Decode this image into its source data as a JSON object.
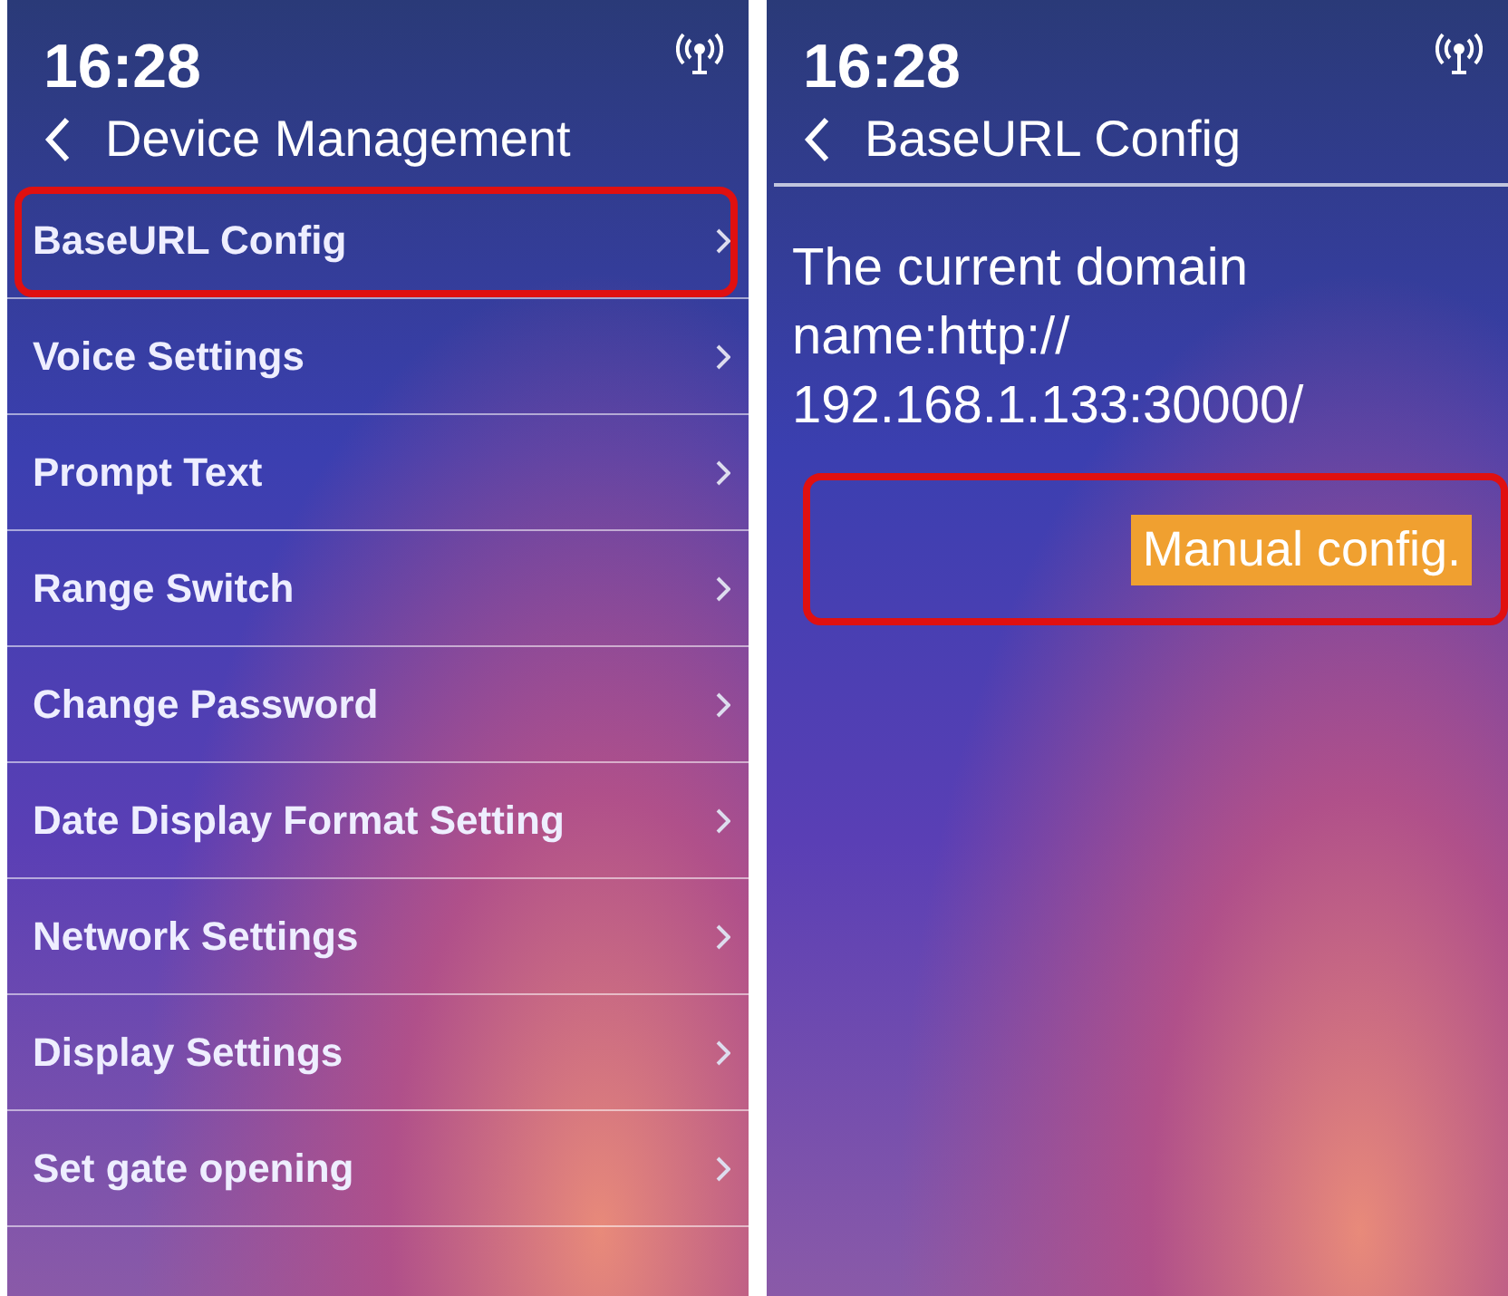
{
  "screens": [
    {
      "time": "16:28",
      "title": "Device Management",
      "items": [
        {
          "label": "BaseURL Config",
          "highlighted": true
        },
        {
          "label": "Voice Settings",
          "highlighted": false
        },
        {
          "label": "Prompt Text",
          "highlighted": false
        },
        {
          "label": "Range Switch",
          "highlighted": false
        },
        {
          "label": "Change Password",
          "highlighted": false
        },
        {
          "label": "Date Display Format Setting",
          "highlighted": false
        },
        {
          "label": "Network Settings",
          "highlighted": false
        },
        {
          "label": "Display Settings",
          "highlighted": false
        },
        {
          "label": "Set gate opening",
          "highlighted": false
        }
      ]
    },
    {
      "time": "16:28",
      "title": "BaseURL Config",
      "message_lines": [
        "The current domain",
        "name:http://",
        "192.168.1.133:30000/"
      ],
      "button": {
        "label": "Manual config.",
        "highlighted": true
      }
    }
  ]
}
